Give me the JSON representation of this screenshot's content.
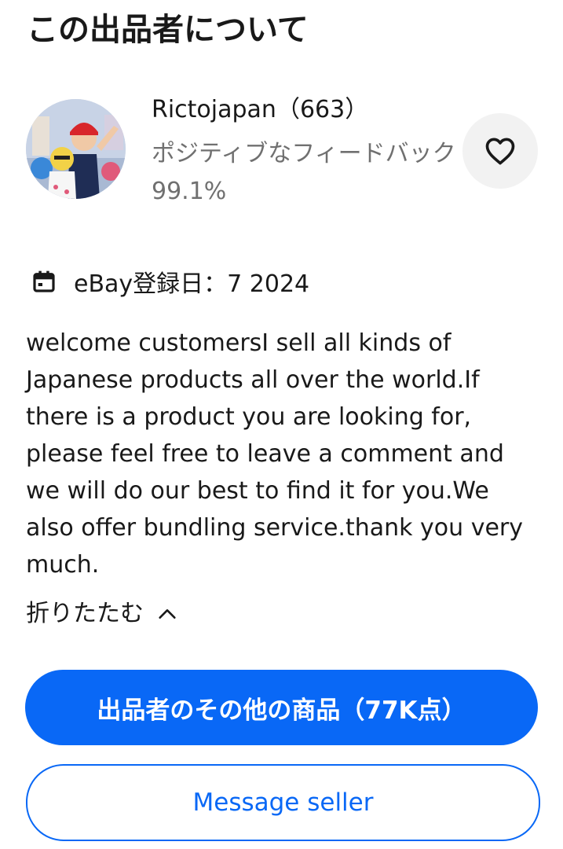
{
  "header": {
    "title": "この出品者について"
  },
  "seller": {
    "name_with_count": "Rictojapan（663）",
    "feedback": "ポジティブなフィードバック 99.1%",
    "follow_icon": "heart-outline-icon",
    "avatar": "seller-avatar-photo"
  },
  "registration": {
    "icon": "calendar-icon",
    "text": "eBay登録日：7 2024"
  },
  "description": {
    "text": "welcome customersI sell all kinds of Japanese products all over the world.If there is a product you are looking for, please feel free to leave a comment and we will do our best to find it for you.We also offer bundling service.thank you very much."
  },
  "collapse": {
    "label": "折りたたむ",
    "icon": "chevron-up-icon"
  },
  "actions": {
    "other_items_label": "出品者のその他の商品（77K点）",
    "message_label": "Message seller"
  },
  "colors": {
    "accent": "#0968f6",
    "text": "#191919",
    "muted": "#707070",
    "follow_bg": "#f2f2f2"
  }
}
